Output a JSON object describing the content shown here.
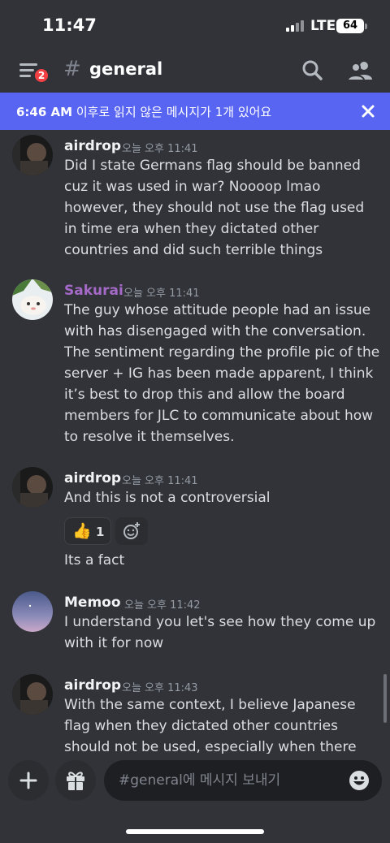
{
  "status_bar": {
    "time": "11:47",
    "network": "LTE",
    "battery": "64"
  },
  "header": {
    "badge_count": "2",
    "hash": "#",
    "channel_name": "general"
  },
  "new_messages_banner": {
    "time": "6:46 AM",
    "text": " 이후로 읽지 않은 메시지가 1개 있어요"
  },
  "messages": [
    {
      "username": "airdrop",
      "timestamp": "오늘 오후 11:41",
      "text": "Did I state Germans flag should be banned cuz it was used in war? Noooop lmao however, they should not use the flag used in time era when they dictated other countries and did such terrible things"
    },
    {
      "username": "Sakurai",
      "username_color": "#9b59b6",
      "timestamp": "오늘 오후 11:41",
      "text": "The guy whose attitude people had an issue with has disengaged with the conversation. The sentiment regarding the profile pic of the server + IG has been made apparent, I think it’s best to drop this and allow the board members for JLC to communicate about how to resolve it themselves."
    },
    {
      "username": "airdrop",
      "timestamp": "오늘 오후 11:41",
      "text": "And this is not a controversial",
      "reaction": {
        "emoji": "👍",
        "count": "1"
      },
      "followup": "Its a fact"
    },
    {
      "username": "Memoo",
      "timestamp": "오늘 오후 11:42",
      "text": "I understand you let's see how they come up with it for now"
    },
    {
      "username": "airdrop",
      "timestamp": "오늘 오후 11:43",
      "text": "With the same context, I believe Japanese flag when they dictated other countries should not be used, especially when there are people from"
    }
  ],
  "composer": {
    "placeholder": "#general에 메시지 보내기"
  },
  "colors": {
    "background": "#313338",
    "accent": "#5865f2",
    "badge": "#f23f43"
  }
}
